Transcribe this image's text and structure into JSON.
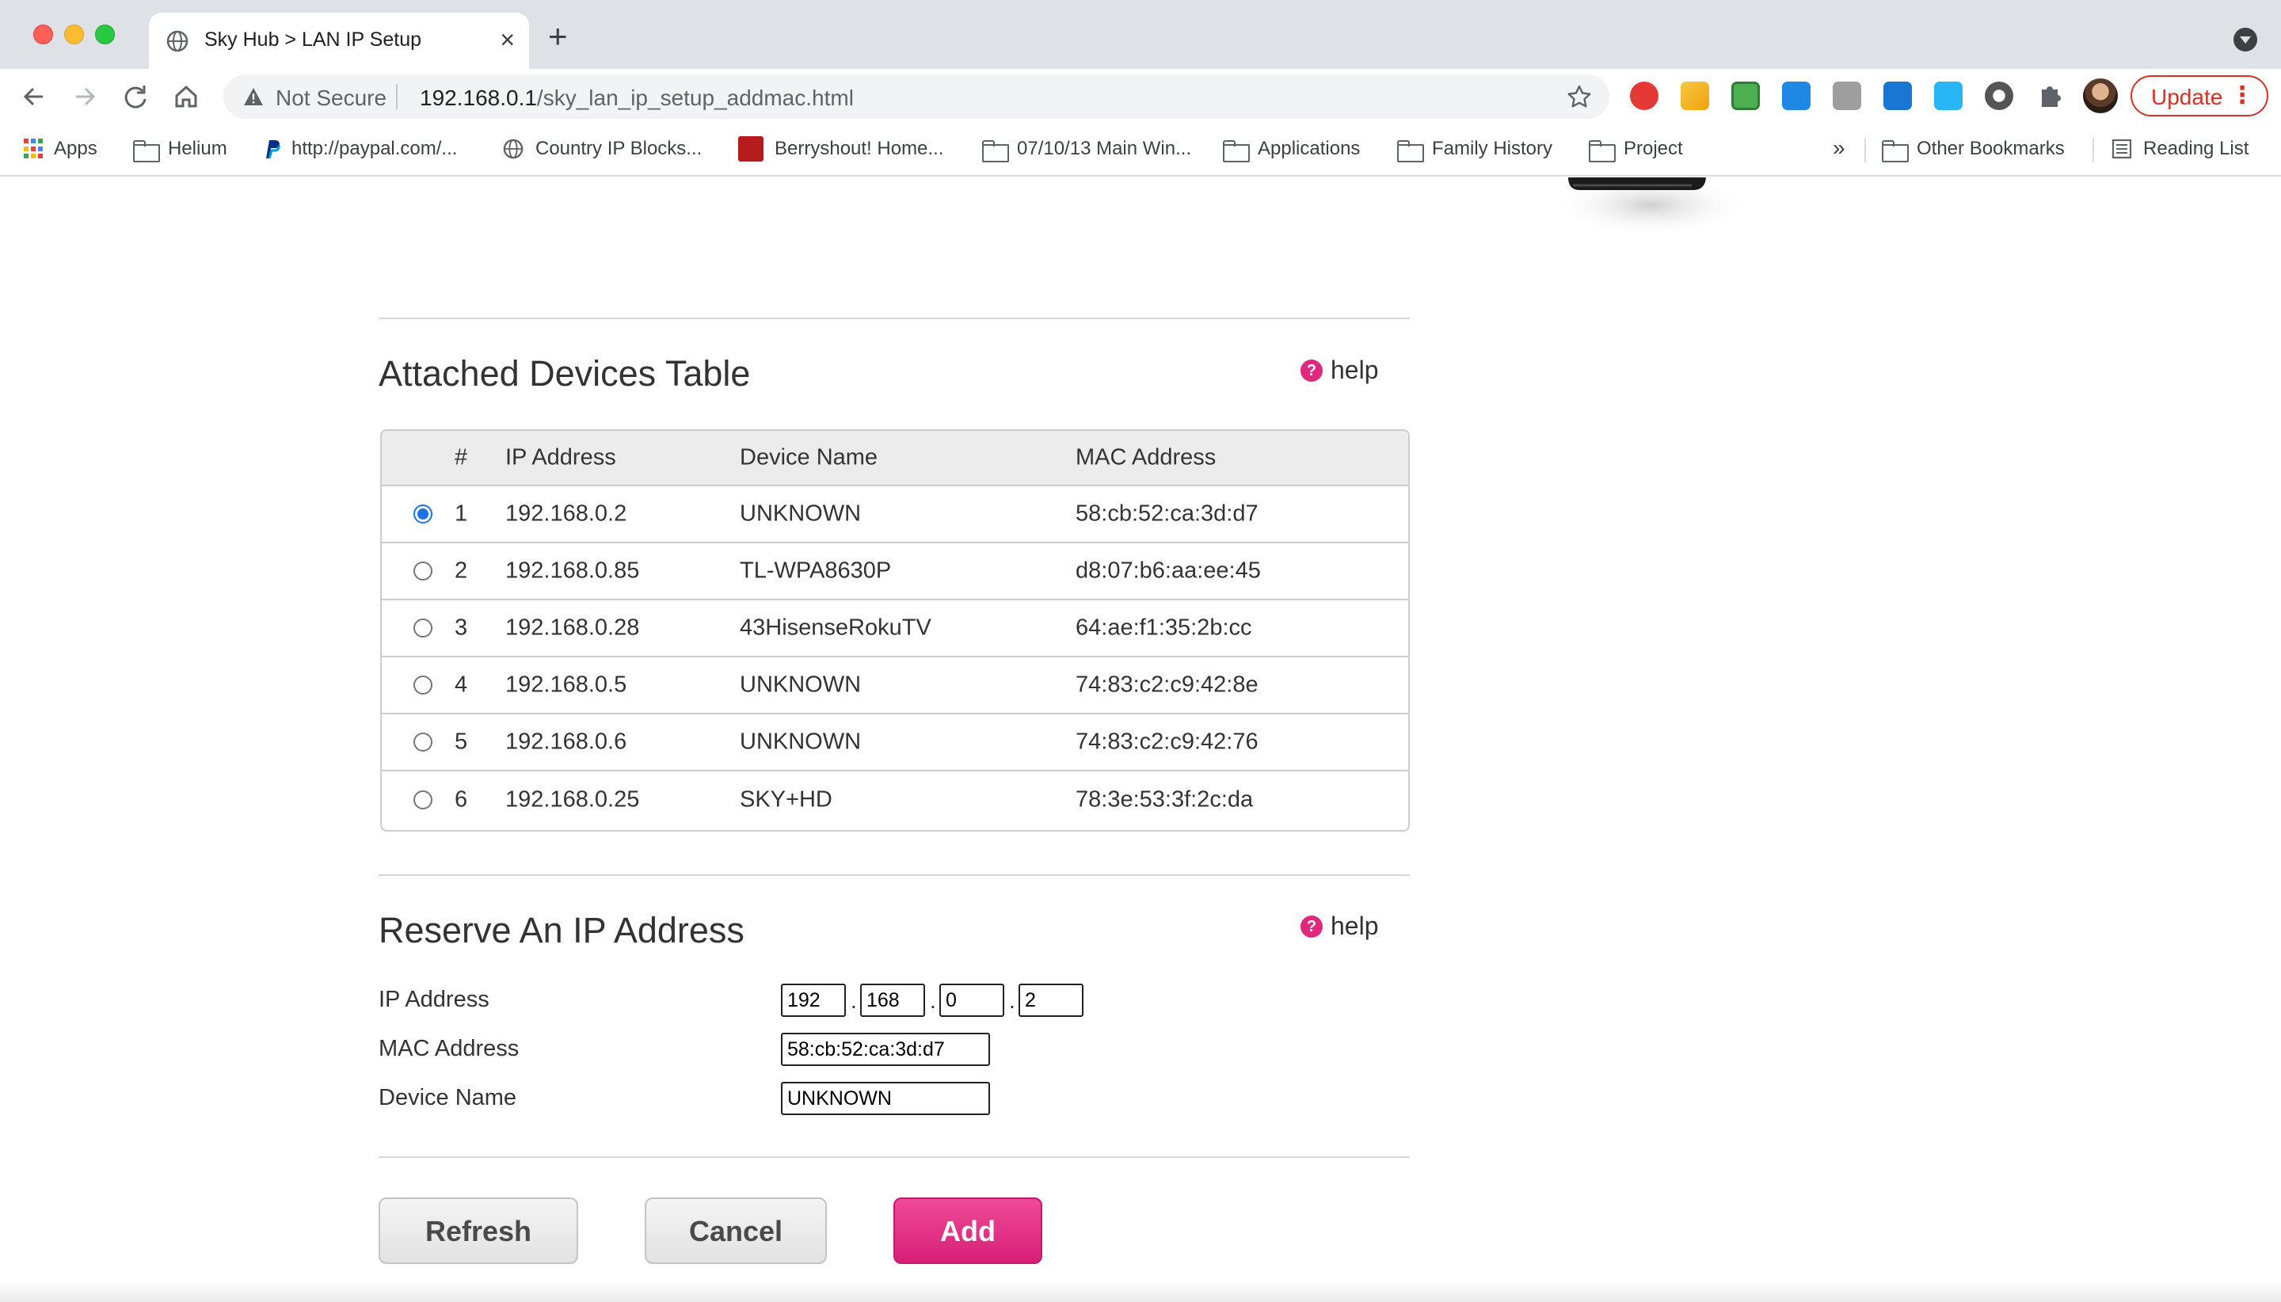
{
  "browser": {
    "tab_title": "Sky Hub > LAN IP Setup",
    "security_label": "Not Secure",
    "url_host": "192.168.0.1",
    "url_path": "/sky_lan_ip_setup_addmac.html",
    "update_label": "Update",
    "bookmarks": [
      {
        "label": "Apps",
        "icon": "apps-grid-icon"
      },
      {
        "label": "Helium",
        "icon": "folder-icon"
      },
      {
        "label": "http://paypal.com/...",
        "icon": "paypal-icon"
      },
      {
        "label": "Country IP Blocks...",
        "icon": "globe-icon"
      },
      {
        "label": "Berryshout! Home...",
        "icon": "berryshout-icon"
      },
      {
        "label": "07/10/13 Main Win...",
        "icon": "folder-icon"
      },
      {
        "label": "Applications",
        "icon": "folder-icon"
      },
      {
        "label": "Family History",
        "icon": "folder-icon"
      },
      {
        "label": "Project",
        "icon": "folder-icon"
      }
    ],
    "bookmarks_overflow": "»",
    "other_bookmarks": "Other Bookmarks",
    "reading_list": "Reading List"
  },
  "attached_devices": {
    "title": "Attached Devices Table",
    "help_label": "help",
    "columns": [
      "#",
      "IP Address",
      "Device Name",
      "MAC Address"
    ],
    "rows": [
      {
        "num": "1",
        "ip": "192.168.0.2",
        "name": "UNKNOWN",
        "mac": "58:cb:52:ca:3d:d7",
        "selected": true
      },
      {
        "num": "2",
        "ip": "192.168.0.85",
        "name": "TL-WPA8630P",
        "mac": "d8:07:b6:aa:ee:45",
        "selected": false
      },
      {
        "num": "3",
        "ip": "192.168.0.28",
        "name": "43HisenseRokuTV",
        "mac": "64:ae:f1:35:2b:cc",
        "selected": false
      },
      {
        "num": "4",
        "ip": "192.168.0.5",
        "name": "UNKNOWN",
        "mac": "74:83:c2:c9:42:8e",
        "selected": false
      },
      {
        "num": "5",
        "ip": "192.168.0.6",
        "name": "UNKNOWN",
        "mac": "74:83:c2:c9:42:76",
        "selected": false
      },
      {
        "num": "6",
        "ip": "192.168.0.25",
        "name": "SKY+HD",
        "mac": "78:3e:53:3f:2c:da",
        "selected": false
      }
    ]
  },
  "reserve": {
    "title": "Reserve An IP Address",
    "help_label": "help",
    "ip_label": "IP Address",
    "ip_octets": [
      "192",
      "168",
      "0",
      "2"
    ],
    "mac_label": "MAC Address",
    "mac_value": "58:cb:52:ca:3d:d7",
    "name_label": "Device Name",
    "name_value": "UNKNOWN"
  },
  "buttons": {
    "refresh": "Refresh",
    "cancel": "Cancel",
    "add": "Add"
  },
  "colors": {
    "accent_pink": "#e0287d",
    "radio_blue": "#1a73e8"
  }
}
